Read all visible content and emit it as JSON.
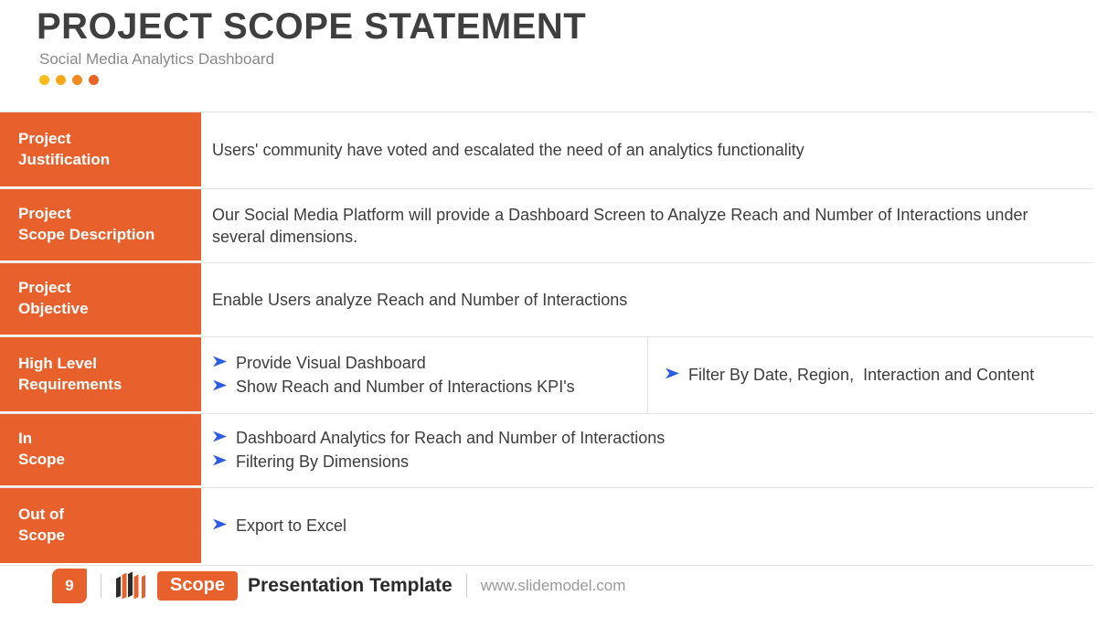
{
  "header": {
    "title": "PROJECT SCOPE STATEMENT",
    "subtitle": "Social Media Analytics Dashboard",
    "dots": [
      {
        "name": "dot-1",
        "color": "#f9bc1a"
      },
      {
        "name": "dot-2",
        "color": "#f7a81b"
      },
      {
        "name": "dot-3",
        "color": "#f18a20"
      },
      {
        "name": "dot-4",
        "color": "#ea6425"
      }
    ]
  },
  "theme": {
    "accent_orange": "#e8612c",
    "bullet_blue": "#2b5ce6",
    "title_gray": "#3f3f3f",
    "subtitle_gray": "#8a8a8a",
    "body_gray": "#3d3d3d",
    "border_gray": "#e3e3e3"
  },
  "table": {
    "rows": [
      {
        "id": "justification",
        "label_lines": [
          "Project",
          "Justification"
        ],
        "type": "paragraph",
        "text": "Users' community have voted and escalated the need of an analytics functionality"
      },
      {
        "id": "scope-description",
        "label_lines": [
          "Project",
          "Scope Description"
        ],
        "type": "paragraph",
        "text": "Our Social Media Platform will provide a Dashboard Screen to Analyze Reach and Number of Interactions under several dimensions."
      },
      {
        "id": "objective",
        "label_lines": [
          "Project",
          "Objective"
        ],
        "type": "paragraph",
        "text": "Enable Users analyze Reach and Number of Interactions"
      },
      {
        "id": "high-level-requirements",
        "label_lines": [
          "High Level",
          "Requirements"
        ],
        "type": "split-bullets",
        "bullets_left": [
          "Provide Visual Dashboard",
          "Show Reach and Number of Interactions KPI's"
        ],
        "bullets_right": [
          "Filter By Date, Region,  Interaction and Content"
        ]
      },
      {
        "id": "in-scope",
        "label_lines": [
          "In",
          "Scope"
        ],
        "type": "bullets",
        "bullets": [
          "Dashboard Analytics for Reach and Number of Interactions",
          "Filtering By Dimensions"
        ]
      },
      {
        "id": "out-of-scope",
        "label_lines": [
          "Out of",
          "Scope"
        ],
        "type": "bullets",
        "bullets": [
          "Export to Excel"
        ]
      }
    ]
  },
  "footer": {
    "page_number": "9",
    "scope_badge": "Scope",
    "title": "Presentation Template",
    "url": "www.slidemodel.com"
  }
}
